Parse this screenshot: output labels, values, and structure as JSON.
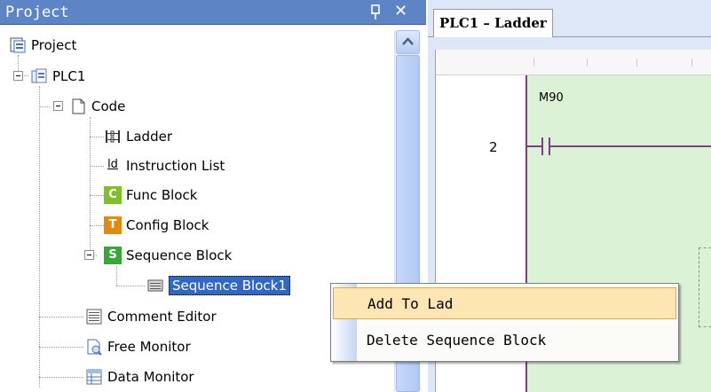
{
  "project_pane": {
    "title": "Project",
    "tree": [
      {
        "label": "Project",
        "icon": "project-icon"
      },
      {
        "label": "PLC1",
        "icon": "plc-icon"
      },
      {
        "label": "Code",
        "icon": "document-icon"
      },
      {
        "label": "Ladder",
        "icon": "ladder-icon"
      },
      {
        "label": "Instruction List",
        "icon": "instruction-list-icon",
        "glyph": "ld"
      },
      {
        "label": "Func Block",
        "icon": "func-block-icon",
        "glyph": "C",
        "color": "#7fbf2a"
      },
      {
        "label": "Config Block",
        "icon": "config-block-icon",
        "glyph": "T",
        "color": "#e08a12"
      },
      {
        "label": "Sequence Block",
        "icon": "sequence-block-icon",
        "glyph": "S",
        "color": "#3aa53a"
      },
      {
        "label": "Sequence Block1",
        "icon": "sequence-item-icon",
        "selected": true
      },
      {
        "label": "Comment Editor",
        "icon": "comment-editor-icon"
      },
      {
        "label": "Free Monitor",
        "icon": "free-monitor-icon"
      },
      {
        "label": "Data Monitor",
        "icon": "data-monitor-icon"
      }
    ]
  },
  "editor": {
    "tab_label": "PLC1 – Ladder",
    "rung_number": "2",
    "contact_label": "M90"
  },
  "context_menu": {
    "items": [
      {
        "label": "Add To Lad",
        "highlighted": true
      },
      {
        "label": "Delete Sequence Block",
        "highlighted": false
      }
    ]
  },
  "colors": {
    "titlebar": "#5d84c4",
    "selection": "#3168c6",
    "rung_background": "#dcf2d7",
    "power_rail": "#7c3f85",
    "menu_highlight": "#fde6b4"
  }
}
